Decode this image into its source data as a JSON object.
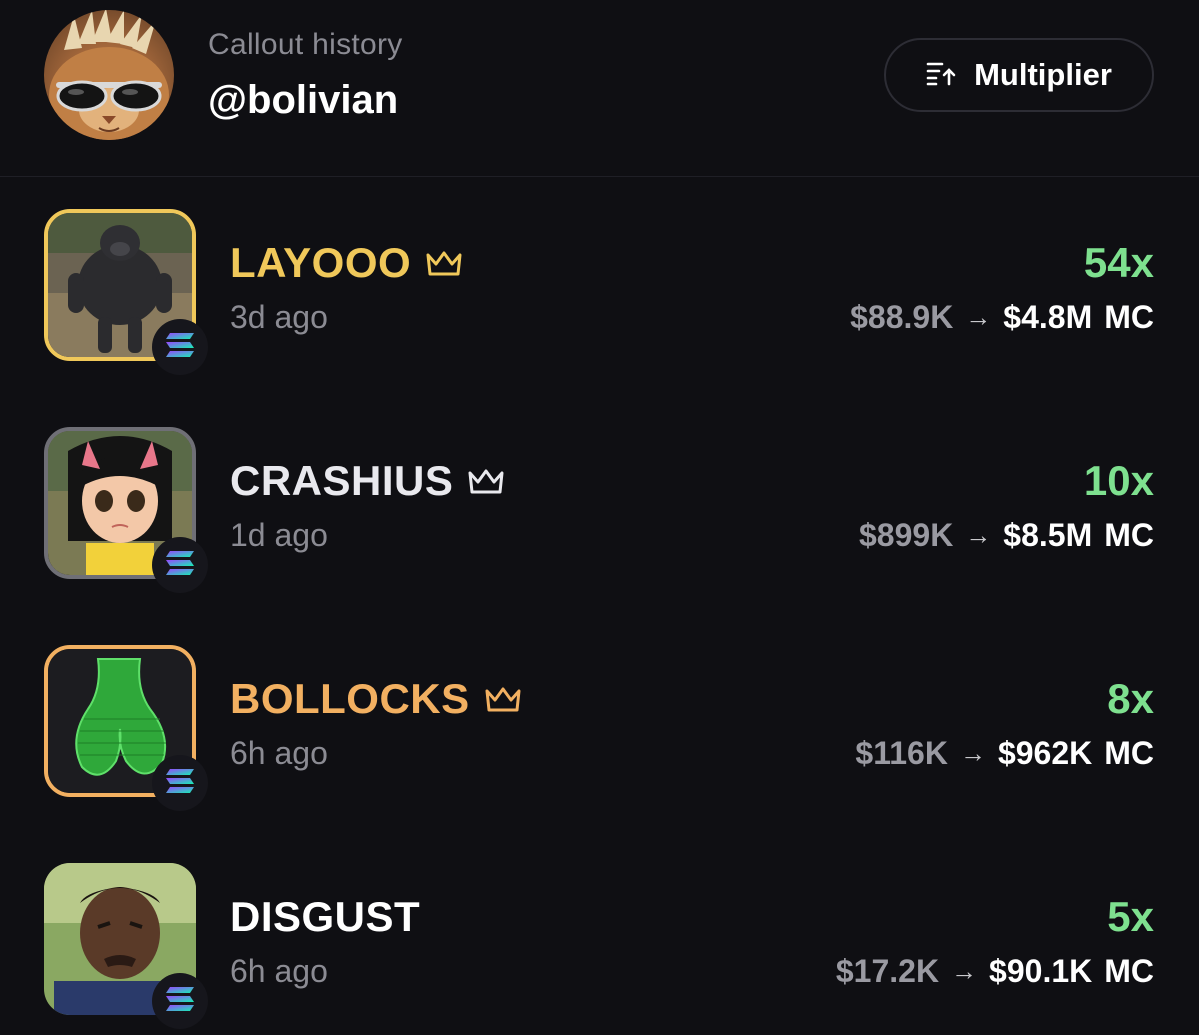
{
  "header": {
    "subtitle": "Callout history",
    "username": "@bolivian",
    "sort_button_label": "Multiplier",
    "sort_icon": "sort-ascending-icon"
  },
  "colors": {
    "background": "#0f0f13",
    "multiplier_green": "#7ee08f",
    "gold": "#f0c85a",
    "orange": "#f2b061",
    "muted_text": "#8b8b93"
  },
  "callouts": [
    {
      "name": "LAYOOO",
      "crown": true,
      "name_color": "#f0c85a",
      "time": "3d ago",
      "multiplier": "54x",
      "mc_from": "$88.9K",
      "mc_to": "$4.8M",
      "mc_unit": "MC",
      "chain_icon": "solana-icon"
    },
    {
      "name": "CRASHIUS",
      "crown": true,
      "name_color": "#e9e9ee",
      "time": "1d ago",
      "multiplier": "10x",
      "mc_from": "$899K",
      "mc_to": "$8.5M",
      "mc_unit": "MC",
      "chain_icon": "solana-icon"
    },
    {
      "name": "BOLLOCKS",
      "crown": true,
      "name_color": "#f2b061",
      "time": "6h ago",
      "multiplier": "8x",
      "mc_from": "$116K",
      "mc_to": "$962K",
      "mc_unit": "MC",
      "chain_icon": "solana-icon"
    },
    {
      "name": "DISGUST",
      "crown": false,
      "name_color": "#ffffff",
      "time": "6h ago",
      "multiplier": "5x",
      "mc_from": "$17.2K",
      "mc_to": "$90.1K",
      "mc_unit": "MC",
      "chain_icon": "solana-icon"
    }
  ]
}
